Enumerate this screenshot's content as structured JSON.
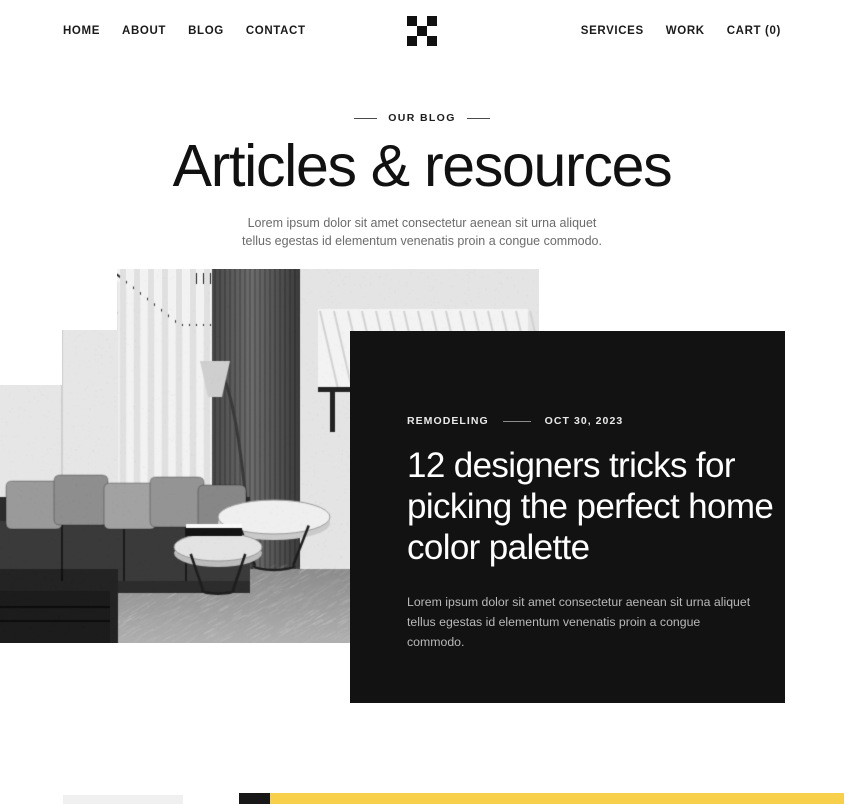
{
  "header": {
    "logo_name": "checkerboard-logo",
    "logo_pattern": [
      1,
      0,
      1,
      0,
      1,
      0,
      1,
      0,
      1
    ],
    "nav_left": [
      {
        "label": "HOME",
        "name": "home"
      },
      {
        "label": "ABOUT",
        "name": "about"
      },
      {
        "label": "BLOG",
        "name": "blog"
      },
      {
        "label": "CONTACT",
        "name": "contact"
      }
    ],
    "nav_right": [
      {
        "label": "SERVICES",
        "name": "services"
      },
      {
        "label": "WORK",
        "name": "work"
      },
      {
        "label": "CART (0)",
        "name": "cart"
      }
    ],
    "cart_count": 0
  },
  "hero": {
    "eyebrow": "OUR BLOG",
    "title": "Articles & resources",
    "subtitle": "Lorem ipsum dolor sit amet consectetur aenean sit urna aliquet tellus egestas id elementum venenatis proin a congue commodo."
  },
  "featured_post": {
    "category": "REMODELING",
    "date": "OCT 30, 2023",
    "title": "12 designers tricks for picking the perfect home color palette",
    "excerpt": "Lorem ipsum dolor sit amet consectetur aenean sit urna aliquet tellus egestas id elementum venenatis proin a congue commodo.",
    "image_alt": "grayscale modern living room with sectional sofa and round coffee tables"
  },
  "colors": {
    "page_background": "#ffffff",
    "card_background": "#121212",
    "text_primary": "#111111",
    "text_muted": "#6b6b6b",
    "card_text_muted": "#b9b9b9",
    "accent_yellow": "#f7cf4a",
    "peek_gray": "#f0f0f0"
  }
}
